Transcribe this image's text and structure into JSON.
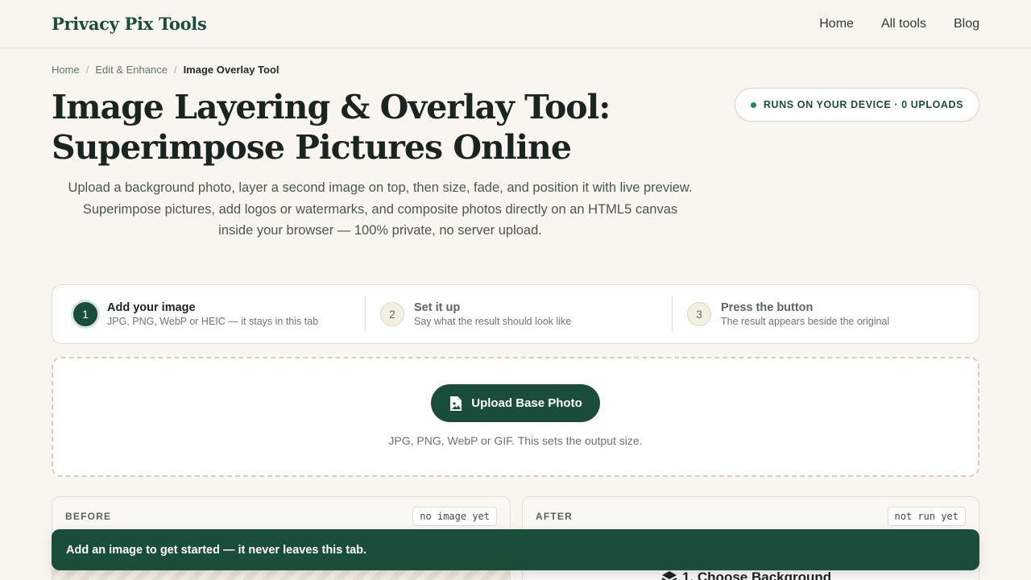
{
  "brand": "Privacy Pix Tools",
  "nav": {
    "home": "Home",
    "all_tools": "All tools",
    "blog": "Blog"
  },
  "breadcrumb": {
    "home": "Home",
    "category": "Edit & Enhance",
    "current": "Image Overlay Tool",
    "separator": "/"
  },
  "hero": {
    "title_line1": "Image Layering & Overlay Tool:",
    "title_line2": "Superimpose Pictures Online",
    "description": "Upload a background photo, layer a second image on top, then size, fade, and position it with live preview. Superimpose pictures, add logos or watermarks, and composite photos directly on an HTML5 canvas inside your browser — 100% private, no server upload."
  },
  "badge": {
    "text": "RUNS ON YOUR DEVICE · 0 UPLOADS"
  },
  "steps": [
    {
      "number": "1",
      "title": "Add your image",
      "subtitle": "JPG, PNG, WebP or HEIC — it stays in this tab"
    },
    {
      "number": "2",
      "title": "Set it up",
      "subtitle": "Say what the result should look like"
    },
    {
      "number": "3",
      "title": "Press the button",
      "subtitle": "The result appears beside the original"
    }
  ],
  "upload": {
    "button_label": "Upload Base Photo",
    "hint": "JPG, PNG, WebP or GIF. This sets the output size."
  },
  "panels": {
    "before": {
      "label": "BEFORE",
      "status": "no image yet"
    },
    "after": {
      "label": "AFTER",
      "status": "not run yet",
      "section_title": "1. Choose Background"
    }
  },
  "toast": {
    "message": "Add an image to get started — it never leaves this tab."
  },
  "colors": {
    "brand": "#1a4d3a",
    "background": "#f9f6f0",
    "accent_dot": "#1f8a5b"
  },
  "icons": {
    "upload": "image-file-icon",
    "section": "layers-icon",
    "badge": "status-dot-icon"
  }
}
